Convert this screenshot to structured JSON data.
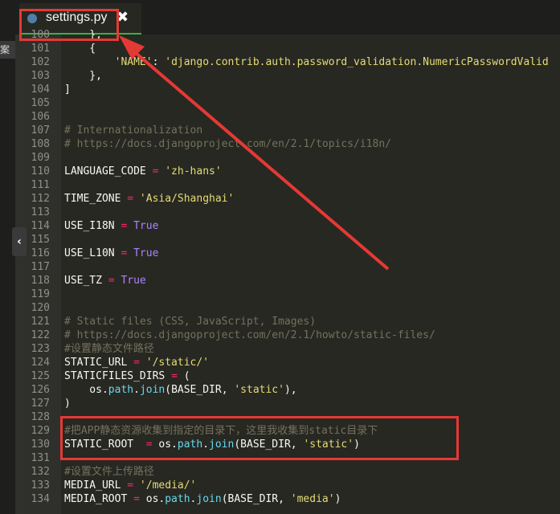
{
  "tab": {
    "filename": "settings.py",
    "icon": "python-icon",
    "close": "✖"
  },
  "left_panel": {
    "label": "案",
    "collapse": "‹"
  },
  "colors": {
    "background": "#272822",
    "string": "#e6db74",
    "keyword": "#ae81ff",
    "function": "#66d9ef",
    "operator": "#f92672",
    "comment": "#75715e",
    "annotation": "#e53935",
    "tab_underline": "#3cb043"
  },
  "lines": [
    {
      "n": "100",
      "t": [
        [
          "",
          "    },"
        ]
      ]
    },
    {
      "n": "101",
      "t": [
        [
          "",
          "    {"
        ]
      ]
    },
    {
      "n": "102",
      "t": [
        [
          "",
          "        "
        ],
        [
          "str",
          "'NAME'"
        ],
        [
          "",
          ": "
        ],
        [
          "str",
          "'django.contrib.auth.password_validation.NumericPasswordValid"
        ]
      ]
    },
    {
      "n": "103",
      "t": [
        [
          "",
          "    },"
        ]
      ]
    },
    {
      "n": "104",
      "t": [
        [
          "",
          "]"
        ]
      ]
    },
    {
      "n": "105",
      "t": []
    },
    {
      "n": "106",
      "t": []
    },
    {
      "n": "107",
      "t": [
        [
          "cm",
          "# Internationalization"
        ]
      ]
    },
    {
      "n": "108",
      "t": [
        [
          "cm",
          "# https://docs.djangoproject.com/en/2.1/topics/i18n/"
        ]
      ]
    },
    {
      "n": "109",
      "t": []
    },
    {
      "n": "110",
      "t": [
        [
          "",
          "LANGUAGE_CODE "
        ],
        [
          "op",
          "="
        ],
        [
          "",
          ""
        ],
        [
          "str",
          " 'zh-hans'"
        ]
      ]
    },
    {
      "n": "111",
      "t": []
    },
    {
      "n": "112",
      "t": [
        [
          "",
          "TIME_ZONE "
        ],
        [
          "op",
          "="
        ],
        [
          "str",
          " 'Asia/Shanghai'"
        ]
      ]
    },
    {
      "n": "113",
      "t": []
    },
    {
      "n": "114",
      "t": [
        [
          "",
          "USE_I18N "
        ],
        [
          "op",
          "="
        ],
        [
          "kw",
          " True"
        ]
      ]
    },
    {
      "n": "115",
      "t": []
    },
    {
      "n": "116",
      "t": [
        [
          "",
          "USE_L10N "
        ],
        [
          "op",
          "="
        ],
        [
          "kw",
          " True"
        ]
      ]
    },
    {
      "n": "117",
      "t": []
    },
    {
      "n": "118",
      "t": [
        [
          "",
          "USE_TZ "
        ],
        [
          "op",
          "="
        ],
        [
          "kw",
          " True"
        ]
      ]
    },
    {
      "n": "119",
      "t": []
    },
    {
      "n": "120",
      "t": []
    },
    {
      "n": "121",
      "t": [
        [
          "cm",
          "# Static files (CSS, JavaScript, Images)"
        ]
      ]
    },
    {
      "n": "122",
      "t": [
        [
          "cm",
          "# https://docs.djangoproject.com/en/2.1/howto/static-files/"
        ]
      ]
    },
    {
      "n": "123",
      "t": [
        [
          "cm",
          "#设置静态文件路径"
        ]
      ]
    },
    {
      "n": "124",
      "t": [
        [
          "",
          "STATIC_URL "
        ],
        [
          "op",
          "="
        ],
        [
          "str",
          " '/static/'"
        ]
      ]
    },
    {
      "n": "125",
      "t": [
        [
          "",
          "STATICFILES_DIRS "
        ],
        [
          "op",
          "="
        ],
        [
          "",
          " ("
        ]
      ]
    },
    {
      "n": "126",
      "t": [
        [
          "",
          "    os."
        ],
        [
          "fn",
          "path"
        ],
        [
          "",
          "."
        ],
        [
          "fn",
          "join"
        ],
        [
          "",
          "(BASE_DIR, "
        ],
        [
          "str",
          "'static'"
        ],
        [
          "",
          "),"
        ]
      ]
    },
    {
      "n": "127",
      "t": [
        [
          "",
          ")"
        ]
      ]
    },
    {
      "n": "128",
      "t": []
    },
    {
      "n": "129",
      "t": [
        [
          "cm",
          "#把APP静态资源收集到指定的目录下，这里我收集到static目录下"
        ]
      ]
    },
    {
      "n": "130",
      "t": [
        [
          "",
          "STATIC_ROOT  "
        ],
        [
          "op",
          "="
        ],
        [
          "",
          " os."
        ],
        [
          "fn",
          "path"
        ],
        [
          "",
          "."
        ],
        [
          "fn",
          "join"
        ],
        [
          "",
          "(BASE_DIR, "
        ],
        [
          "str",
          "'static'"
        ],
        [
          "",
          ")"
        ]
      ]
    },
    {
      "n": "131",
      "t": []
    },
    {
      "n": "132",
      "t": [
        [
          "cm",
          "#设置文件上传路径"
        ]
      ]
    },
    {
      "n": "133",
      "t": [
        [
          "",
          "MEDIA_URL "
        ],
        [
          "op",
          "="
        ],
        [
          "str",
          " '/media/'"
        ]
      ]
    },
    {
      "n": "134",
      "t": [
        [
          "",
          "MEDIA_ROOT "
        ],
        [
          "op",
          "="
        ],
        [
          "",
          " os."
        ],
        [
          "fn",
          "path"
        ],
        [
          "",
          "."
        ],
        [
          "fn",
          "join"
        ],
        [
          "",
          "(BASE_DIR, "
        ],
        [
          "str",
          "'media'"
        ],
        [
          "",
          ")"
        ]
      ]
    }
  ]
}
